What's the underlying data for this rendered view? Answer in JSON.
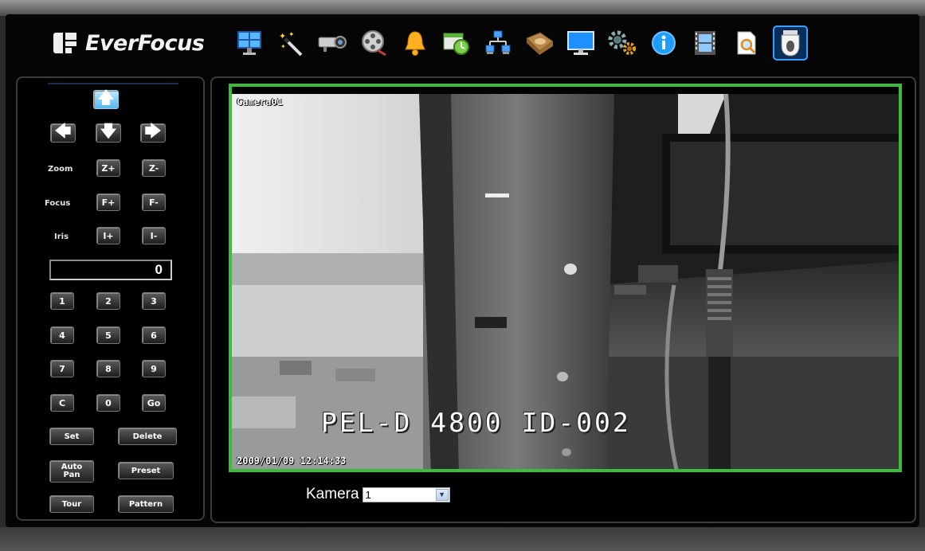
{
  "brand": {
    "name": "EverFocus"
  },
  "toolbar": {
    "icons": [
      "live-view-icon",
      "wizard-icon",
      "camera-icon",
      "film-reel-icon",
      "alarm-bell-icon",
      "schedule-icon",
      "network-icon",
      "disk-icon",
      "display-icon",
      "settings-gears-icon",
      "info-icon",
      "film-strip-icon",
      "search-document-icon",
      "ptz-dome-icon"
    ],
    "active_icon": "ptz-dome-icon"
  },
  "ptz": {
    "zoom_label": "Zoom",
    "focus_label": "Focus",
    "iris_label": "Iris",
    "zoom_in": "Z+",
    "zoom_out": "Z-",
    "focus_in": "F+",
    "focus_out": "F-",
    "iris_open": "I+",
    "iris_close": "I-",
    "display_value": "0",
    "keypad": [
      "1",
      "2",
      "3",
      "4",
      "5",
      "6",
      "7",
      "8",
      "9",
      "C",
      "0",
      "Go"
    ],
    "set_label": "Set",
    "delete_label": "Delete",
    "autopan_line1": "Auto",
    "autopan_line2": "Pan",
    "preset_label": "Preset",
    "tour_label": "Tour",
    "pattern_label": "Pattern"
  },
  "video": {
    "camera_name": "Camera01",
    "timestamp": "2009/01/09  12:14:33",
    "overlay_text": "PEL-D 4800 ID-002",
    "border_color": "#3dbb3d"
  },
  "camera_select": {
    "label": "Kamera",
    "value": "1"
  }
}
